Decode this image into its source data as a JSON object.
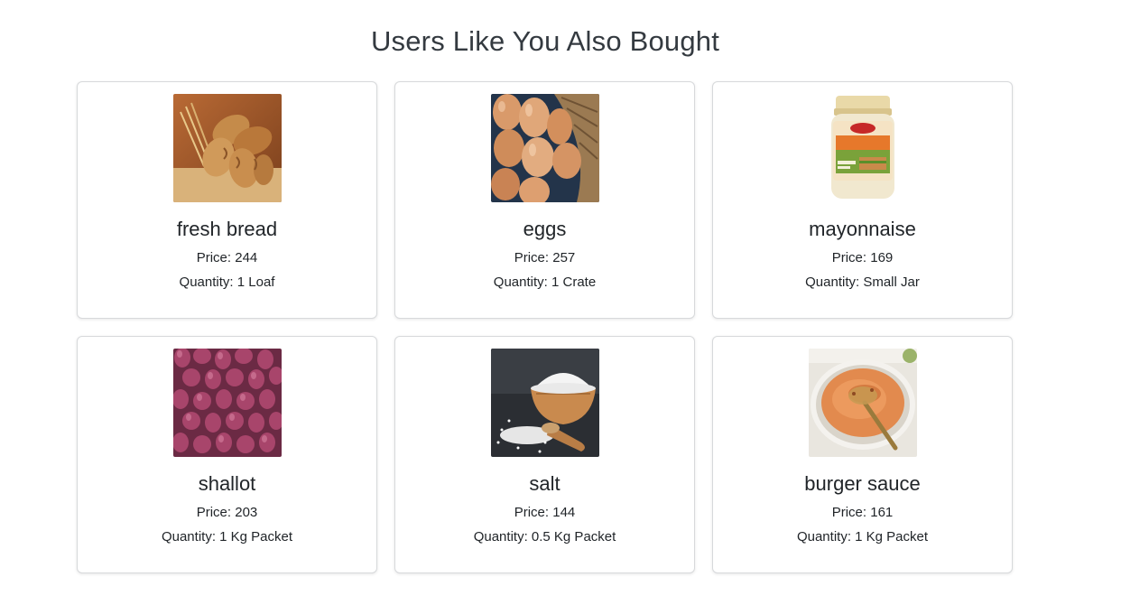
{
  "section": {
    "title": "Users Like You Also Bought"
  },
  "products": [
    {
      "name": "fresh bread",
      "price_label": "Price: 244",
      "quantity_label": "Quantity: 1 Loaf",
      "image": "bread-image"
    },
    {
      "name": "eggs",
      "price_label": "Price: 257",
      "quantity_label": "Quantity: 1 Crate",
      "image": "eggs-image"
    },
    {
      "name": "mayonnaise",
      "price_label": "Price: 169",
      "quantity_label": "Quantity: Small Jar",
      "image": "mayonnaise-jar-image"
    },
    {
      "name": "shallot",
      "price_label": "Price: 203",
      "quantity_label": "Quantity: 1 Kg Packet",
      "image": "shallots-image"
    },
    {
      "name": "salt",
      "price_label": "Price: 144",
      "quantity_label": "Quantity: 0.5 Kg Packet",
      "image": "salt-bowl-image"
    },
    {
      "name": "burger sauce",
      "price_label": "Price: 161",
      "quantity_label": "Quantity: 1 Kg Packet",
      "image": "burger-sauce-image"
    }
  ]
}
